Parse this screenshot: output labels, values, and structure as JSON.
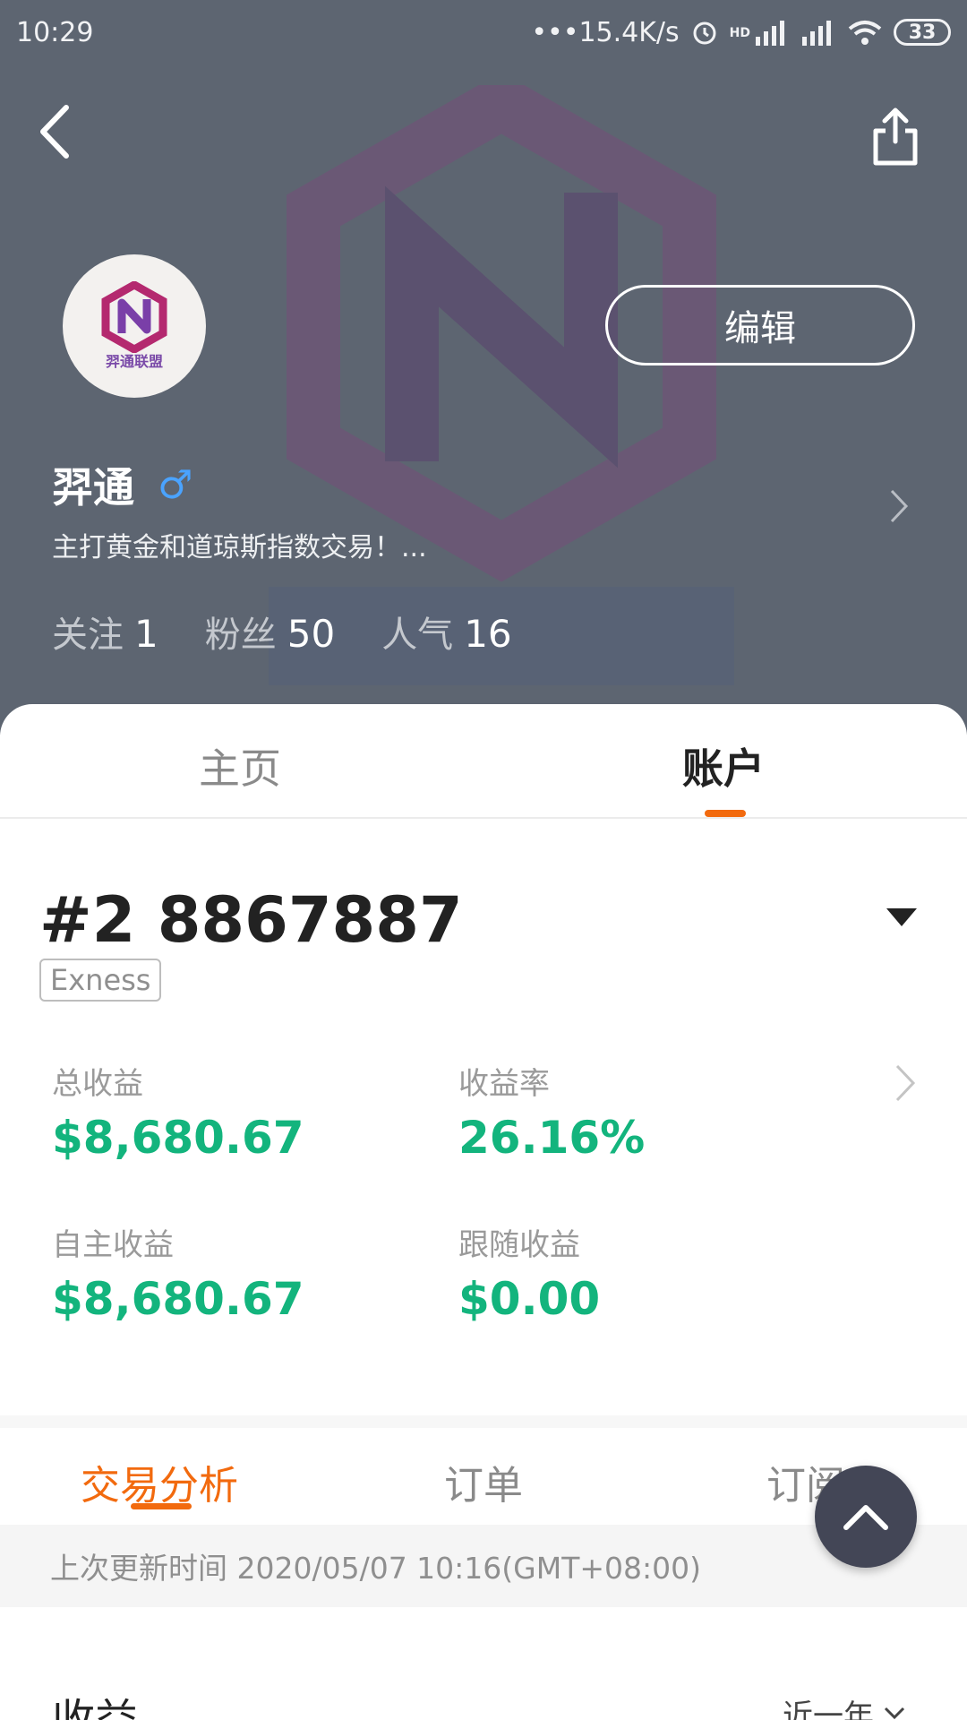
{
  "status_bar": {
    "time": "10:29",
    "network_speed": "•••15.4K/s",
    "hd_label": "HD",
    "battery": "33"
  },
  "profile": {
    "avatar_text": "羿通联盟",
    "edit_label": "编辑",
    "name": "羿通",
    "gender_symbol": "♂",
    "bio": "主打黄金和道琼斯指数交易！...",
    "stats": [
      {
        "label": "关注",
        "value": "1"
      },
      {
        "label": "粉丝",
        "value": "50"
      },
      {
        "label": "人气",
        "value": "16"
      }
    ]
  },
  "main_tabs": [
    {
      "label": "主页",
      "active": false
    },
    {
      "label": "账户",
      "active": true
    }
  ],
  "account": {
    "id": "#2 8867887",
    "broker": "Exness"
  },
  "metrics": [
    {
      "label": "总收益",
      "value": "$8,680.67"
    },
    {
      "label": "收益率",
      "value": "26.16%"
    },
    {
      "label": "自主收益",
      "value": "$8,680.67"
    },
    {
      "label": "跟随收益",
      "value": "$0.00"
    }
  ],
  "sub_tabs": [
    {
      "label": "交易分析",
      "active": true
    },
    {
      "label": "订单",
      "active": false
    },
    {
      "label": "订阅",
      "active": false
    }
  ],
  "last_update": "上次更新时间 2020/05/07 10:16(GMT+08:00)",
  "section": {
    "title": "收益",
    "period": "近一年"
  },
  "colors": {
    "accent": "#f26a0e",
    "gain": "#13b47d",
    "header_bg": "#5d6571"
  }
}
